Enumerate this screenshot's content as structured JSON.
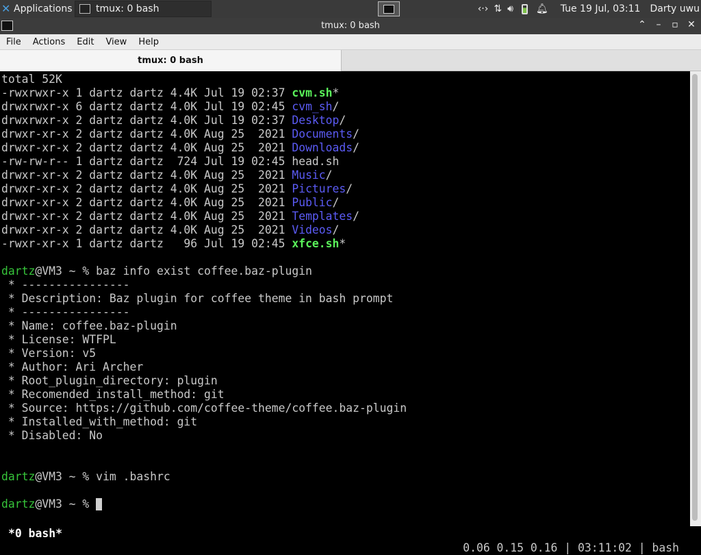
{
  "panel": {
    "applications_label": "Applications",
    "task_label": "tmux: 0 bash",
    "datetime": "Tue 19 Jul, 03:11",
    "user": "Darty uwu"
  },
  "window": {
    "title": "tmux: 0 bash",
    "menu": [
      "File",
      "Actions",
      "Edit",
      "View",
      "Help"
    ],
    "tab_label": "tmux: 0 bash"
  },
  "terminal": {
    "total": "total 52K",
    "listing": [
      {
        "meta": "-rwxrwxr-x 1 dartz dartz 4.4K Jul 19 02:37 ",
        "name": "cvm.sh",
        "suffix": "*",
        "kind": "exec"
      },
      {
        "meta": "drwxrwxr-x 6 dartz dartz 4.0K Jul 19 02:45 ",
        "name": "cvm_sh",
        "suffix": "/",
        "kind": "dir"
      },
      {
        "meta": "drwxrwxr-x 2 dartz dartz 4.0K Jul 19 02:37 ",
        "name": "Desktop",
        "suffix": "/",
        "kind": "dir"
      },
      {
        "meta": "drwxr-xr-x 2 dartz dartz 4.0K Aug 25  2021 ",
        "name": "Documents",
        "suffix": "/",
        "kind": "dir"
      },
      {
        "meta": "drwxr-xr-x 2 dartz dartz 4.0K Aug 25  2021 ",
        "name": "Downloads",
        "suffix": "/",
        "kind": "dir"
      },
      {
        "meta": "-rw-rw-r-- 1 dartz dartz  724 Jul 19 02:45 ",
        "name": "head.sh",
        "suffix": "",
        "kind": "file"
      },
      {
        "meta": "drwxr-xr-x 2 dartz dartz 4.0K Aug 25  2021 ",
        "name": "Music",
        "suffix": "/",
        "kind": "dir"
      },
      {
        "meta": "drwxr-xr-x 2 dartz dartz 4.0K Aug 25  2021 ",
        "name": "Pictures",
        "suffix": "/",
        "kind": "dir"
      },
      {
        "meta": "drwxr-xr-x 2 dartz dartz 4.0K Aug 25  2021 ",
        "name": "Public",
        "suffix": "/",
        "kind": "dir"
      },
      {
        "meta": "drwxr-xr-x 2 dartz dartz 4.0K Aug 25  2021 ",
        "name": "Templates",
        "suffix": "/",
        "kind": "dir"
      },
      {
        "meta": "drwxr-xr-x 2 dartz dartz 4.0K Aug 25  2021 ",
        "name": "Videos",
        "suffix": "/",
        "kind": "dir"
      },
      {
        "meta": "-rwxr-xr-x 1 dartz dartz   96 Jul 19 02:45 ",
        "name": "xfce.sh",
        "suffix": "*",
        "kind": "exec"
      }
    ],
    "prompt_user": "dartz",
    "prompt_rest": "@VM3 ~ % ",
    "cmd1": "baz info exist coffee.baz-plugin",
    "info_lines": [
      " * ----------------",
      " * Description: Baz plugin for coffee theme in bash prompt",
      " * ----------------",
      " * Name: coffee.baz-plugin",
      " * License: WTFPL",
      " * Version: v5",
      " * Author: Ari Archer",
      " * Root_plugin_directory: plugin",
      " * Recomended_install_method: git",
      " * Source: https://github.com/coffee-theme/coffee.baz-plugin",
      " * Installed_with_method: git",
      " * Disabled: No"
    ],
    "cmd2": "vim .bashrc"
  },
  "status": {
    "left": "*0 bash*",
    "right": "0.06 0.15 0.16 | 03:11:02 | bash"
  },
  "colors": {
    "prompt_green": "#36c43a",
    "dir_blue": "#5b5bf5",
    "exec_green": "#5af35a"
  }
}
